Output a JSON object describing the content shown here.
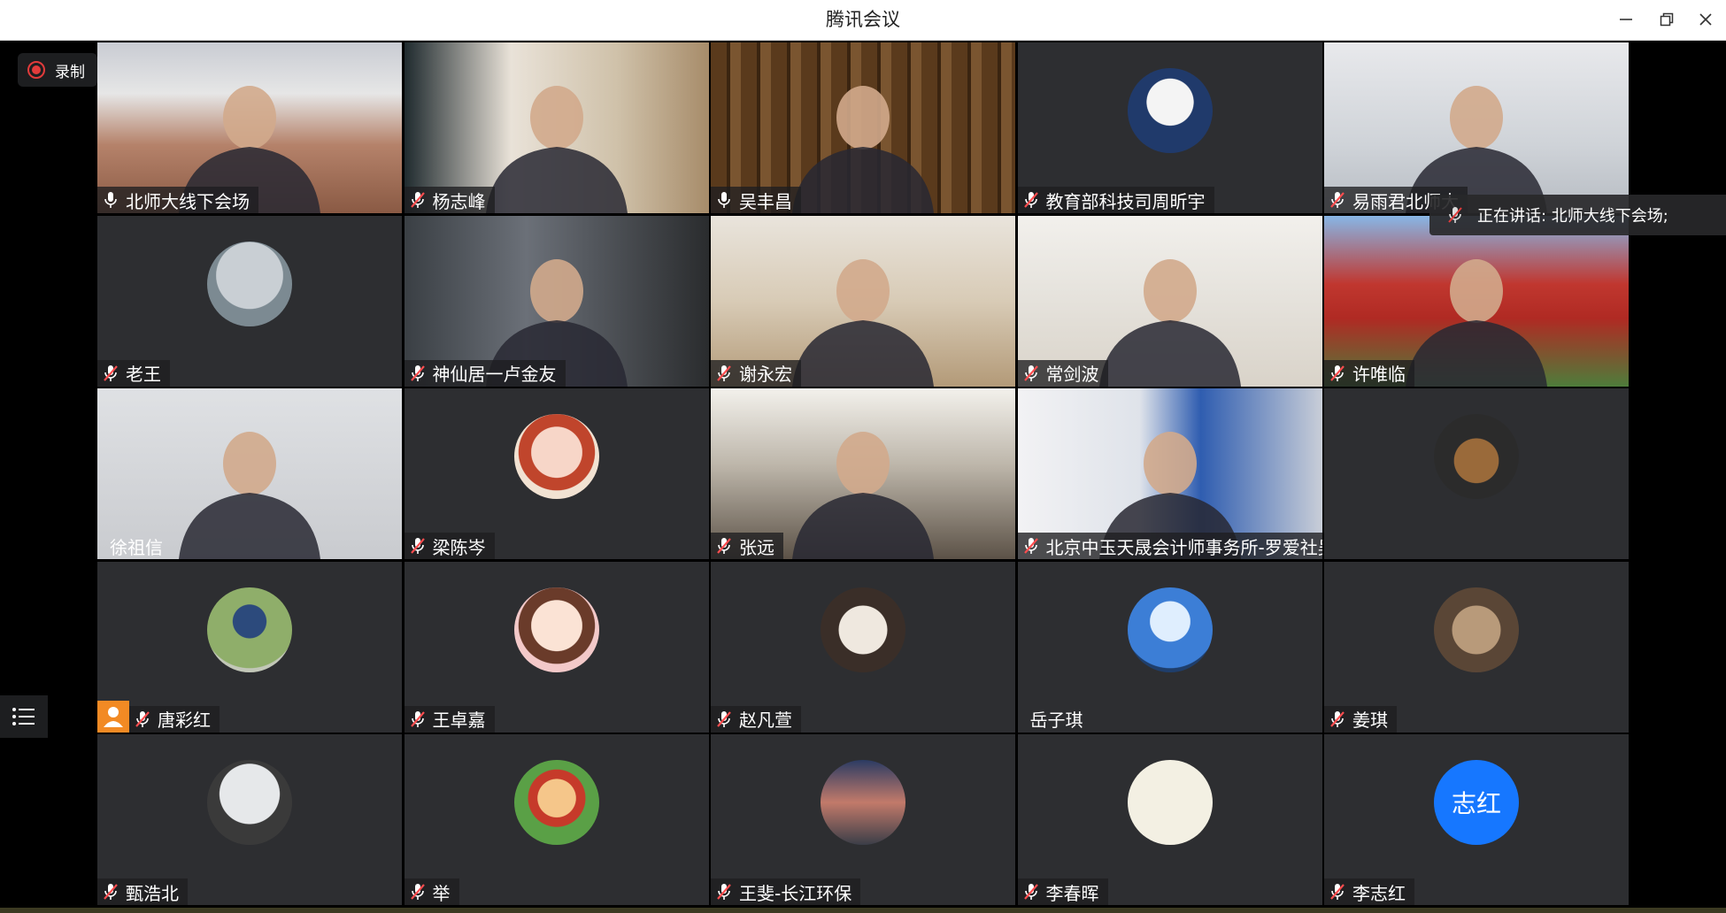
{
  "window": {
    "title": "腾讯会议"
  },
  "controls": {
    "record_label": "录制"
  },
  "speaking": {
    "text": "正在讲话: 北师大线下会场;"
  },
  "participants": [
    {
      "name": "北师大线下会场",
      "mic": "on",
      "type": "video",
      "scene": "room"
    },
    {
      "name": "杨志峰",
      "mic": "off",
      "type": "video",
      "scene": "office1"
    },
    {
      "name": "吴丰昌",
      "mic": "on",
      "type": "video",
      "scene": "books"
    },
    {
      "name": "教育部科技司周昕宇",
      "mic": "off",
      "type": "avatar",
      "scene": "grad"
    },
    {
      "name": "易雨君北师大",
      "mic": "off",
      "type": "video",
      "scene": "woman1"
    },
    {
      "name": "老王",
      "mic": "off",
      "type": "avatar",
      "scene": "lake"
    },
    {
      "name": "神仙居一卢金友",
      "mic": "off",
      "type": "video",
      "scene": "office2"
    },
    {
      "name": "谢永宏",
      "mic": "off",
      "type": "video",
      "scene": "shelf"
    },
    {
      "name": "常剑波",
      "mic": "off",
      "type": "video",
      "scene": "calligraphy"
    },
    {
      "name": "许唯临",
      "mic": "off",
      "type": "video",
      "scene": "pavilion"
    },
    {
      "name": "徐祖信",
      "mic": "none",
      "type": "video",
      "scene": "woman2"
    },
    {
      "name": "梁陈岑",
      "mic": "off",
      "type": "avatar",
      "scene": "cartoon1"
    },
    {
      "name": "张远",
      "mic": "off",
      "type": "video",
      "scene": "office3"
    },
    {
      "name": "北京中玉天晟会计师事务所-罗爱社吴秋双",
      "mic": "off",
      "type": "video",
      "scene": "blueroom"
    },
    {
      "name": "",
      "mic": "none",
      "type": "avatar",
      "scene": "toy"
    },
    {
      "name": "唐彩红",
      "mic": "off",
      "type": "avatar",
      "scene": "hat",
      "host": true
    },
    {
      "name": "王卓嘉",
      "mic": "off",
      "type": "avatar",
      "scene": "cartoon2"
    },
    {
      "name": "赵凡萱",
      "mic": "off",
      "type": "avatar",
      "scene": "girl"
    },
    {
      "name": "岳子琪",
      "mic": "none",
      "type": "avatar",
      "scene": "sky"
    },
    {
      "name": "姜琪",
      "mic": "off",
      "type": "avatar",
      "scene": "cats"
    },
    {
      "name": "甄浩北",
      "mic": "off",
      "type": "avatar",
      "scene": "silhouette"
    },
    {
      "name": "举",
      "mic": "off",
      "type": "avatar",
      "scene": "luffy"
    },
    {
      "name": "王斐-长江环保",
      "mic": "off",
      "type": "avatar",
      "scene": "city"
    },
    {
      "name": "李春晖",
      "mic": "off",
      "type": "avatar",
      "scene": "calligraphy2"
    },
    {
      "name": "李志红",
      "mic": "off",
      "type": "avatar",
      "scene": "text",
      "avatar_text": "志红"
    }
  ]
}
